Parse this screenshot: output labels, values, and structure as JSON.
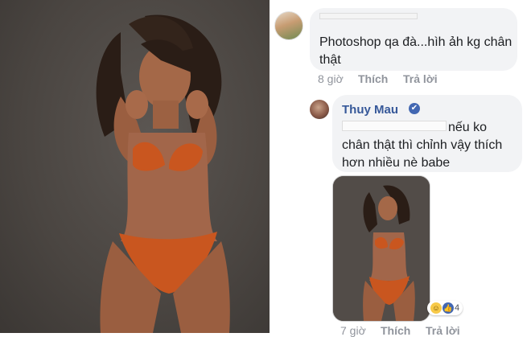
{
  "comment1": {
    "text": "Photoshop qa đà...hìh ảh kg chân thật",
    "time": "8 giờ",
    "like": "Thích",
    "reply": "Trả lời"
  },
  "comment2": {
    "author": "Thuy Mau",
    "text": "nếu ko chân thật thì chỉnh vậy thích hơn nhiều nè babe",
    "reaction_count": "4",
    "time": "7 giờ",
    "like": "Thích",
    "reply": "Trả lời"
  },
  "icons": [
    "verified-badge",
    "haha-reaction",
    "like-reaction"
  ],
  "colors": {
    "name": "#365899",
    "meta": "#90949c",
    "bubble": "#f2f3f5",
    "swimsuit": "#c9561f"
  }
}
